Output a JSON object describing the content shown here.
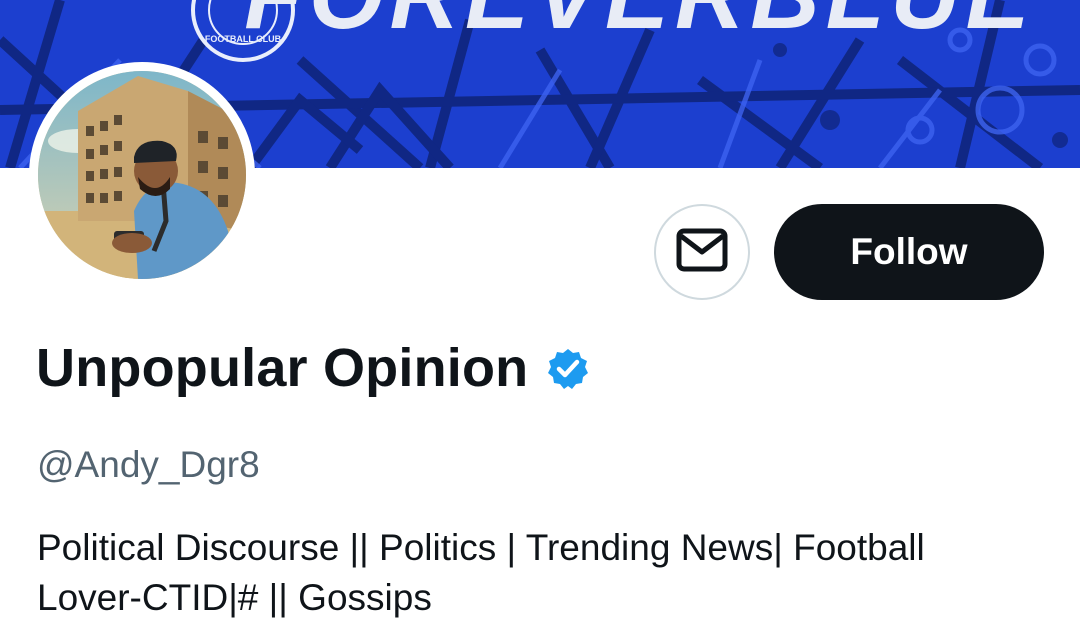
{
  "header": {
    "banner_text": "FOREVERBLUE",
    "banner_crest_text": "FOOTBALL CLUB",
    "banner_color": "#1b3fd0"
  },
  "profile": {
    "display_name": "Unpopular Opinion",
    "verified": true,
    "verified_color": "#1d9bf0",
    "handle": "@Andy_Dgr8",
    "bio_line1": "Political Discourse || Politics | Trending News| Football",
    "bio_line2": "Lover-CTID|# || Gossips"
  },
  "actions": {
    "message_icon": "envelope-icon",
    "follow_label": "Follow"
  }
}
